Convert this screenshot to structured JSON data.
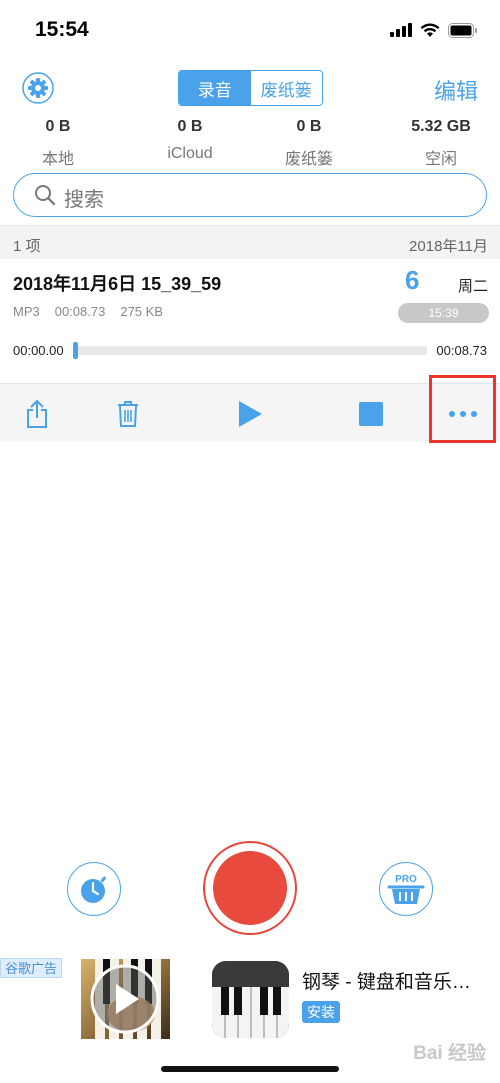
{
  "status": {
    "time": "15:54"
  },
  "top": {
    "segments": [
      {
        "label": "录音",
        "active": true
      },
      {
        "label": "废纸篓",
        "active": false
      }
    ],
    "edit_label": "编辑"
  },
  "stats": [
    {
      "value": "0 B",
      "label": "本地"
    },
    {
      "value": "0 B",
      "label": "iCloud"
    },
    {
      "value": "0 B",
      "label": "废纸篓"
    },
    {
      "value": "5.32 GB",
      "label": "空闲"
    }
  ],
  "search": {
    "placeholder": "搜索"
  },
  "list_header": {
    "count": "1 项",
    "month": "2018年11月"
  },
  "recording": {
    "title": "2018年11月6日 15_39_59",
    "format": "MP3",
    "duration": "00:08.73",
    "size": "275 KB",
    "day": "6",
    "weekday": "周二",
    "time": "15:39",
    "position": "00:00.00",
    "total": "00:08.73",
    "progress_fraction": 0.0
  },
  "colors": {
    "accent": "#4aa3ea",
    "record": "#e84b3e",
    "highlight": "#e8362a"
  },
  "icons": {
    "actions": [
      "share-icon",
      "trash-icon",
      "play-icon",
      "stop-icon",
      "more-icon"
    ],
    "bottom": [
      "timer-icon",
      "record-icon",
      "pro-basket-icon"
    ]
  },
  "ad": {
    "label": "谷歌广告",
    "title": "钢琴 - 键盘和音乐…",
    "install": "安装"
  },
  "watermark": "Bai 经验"
}
